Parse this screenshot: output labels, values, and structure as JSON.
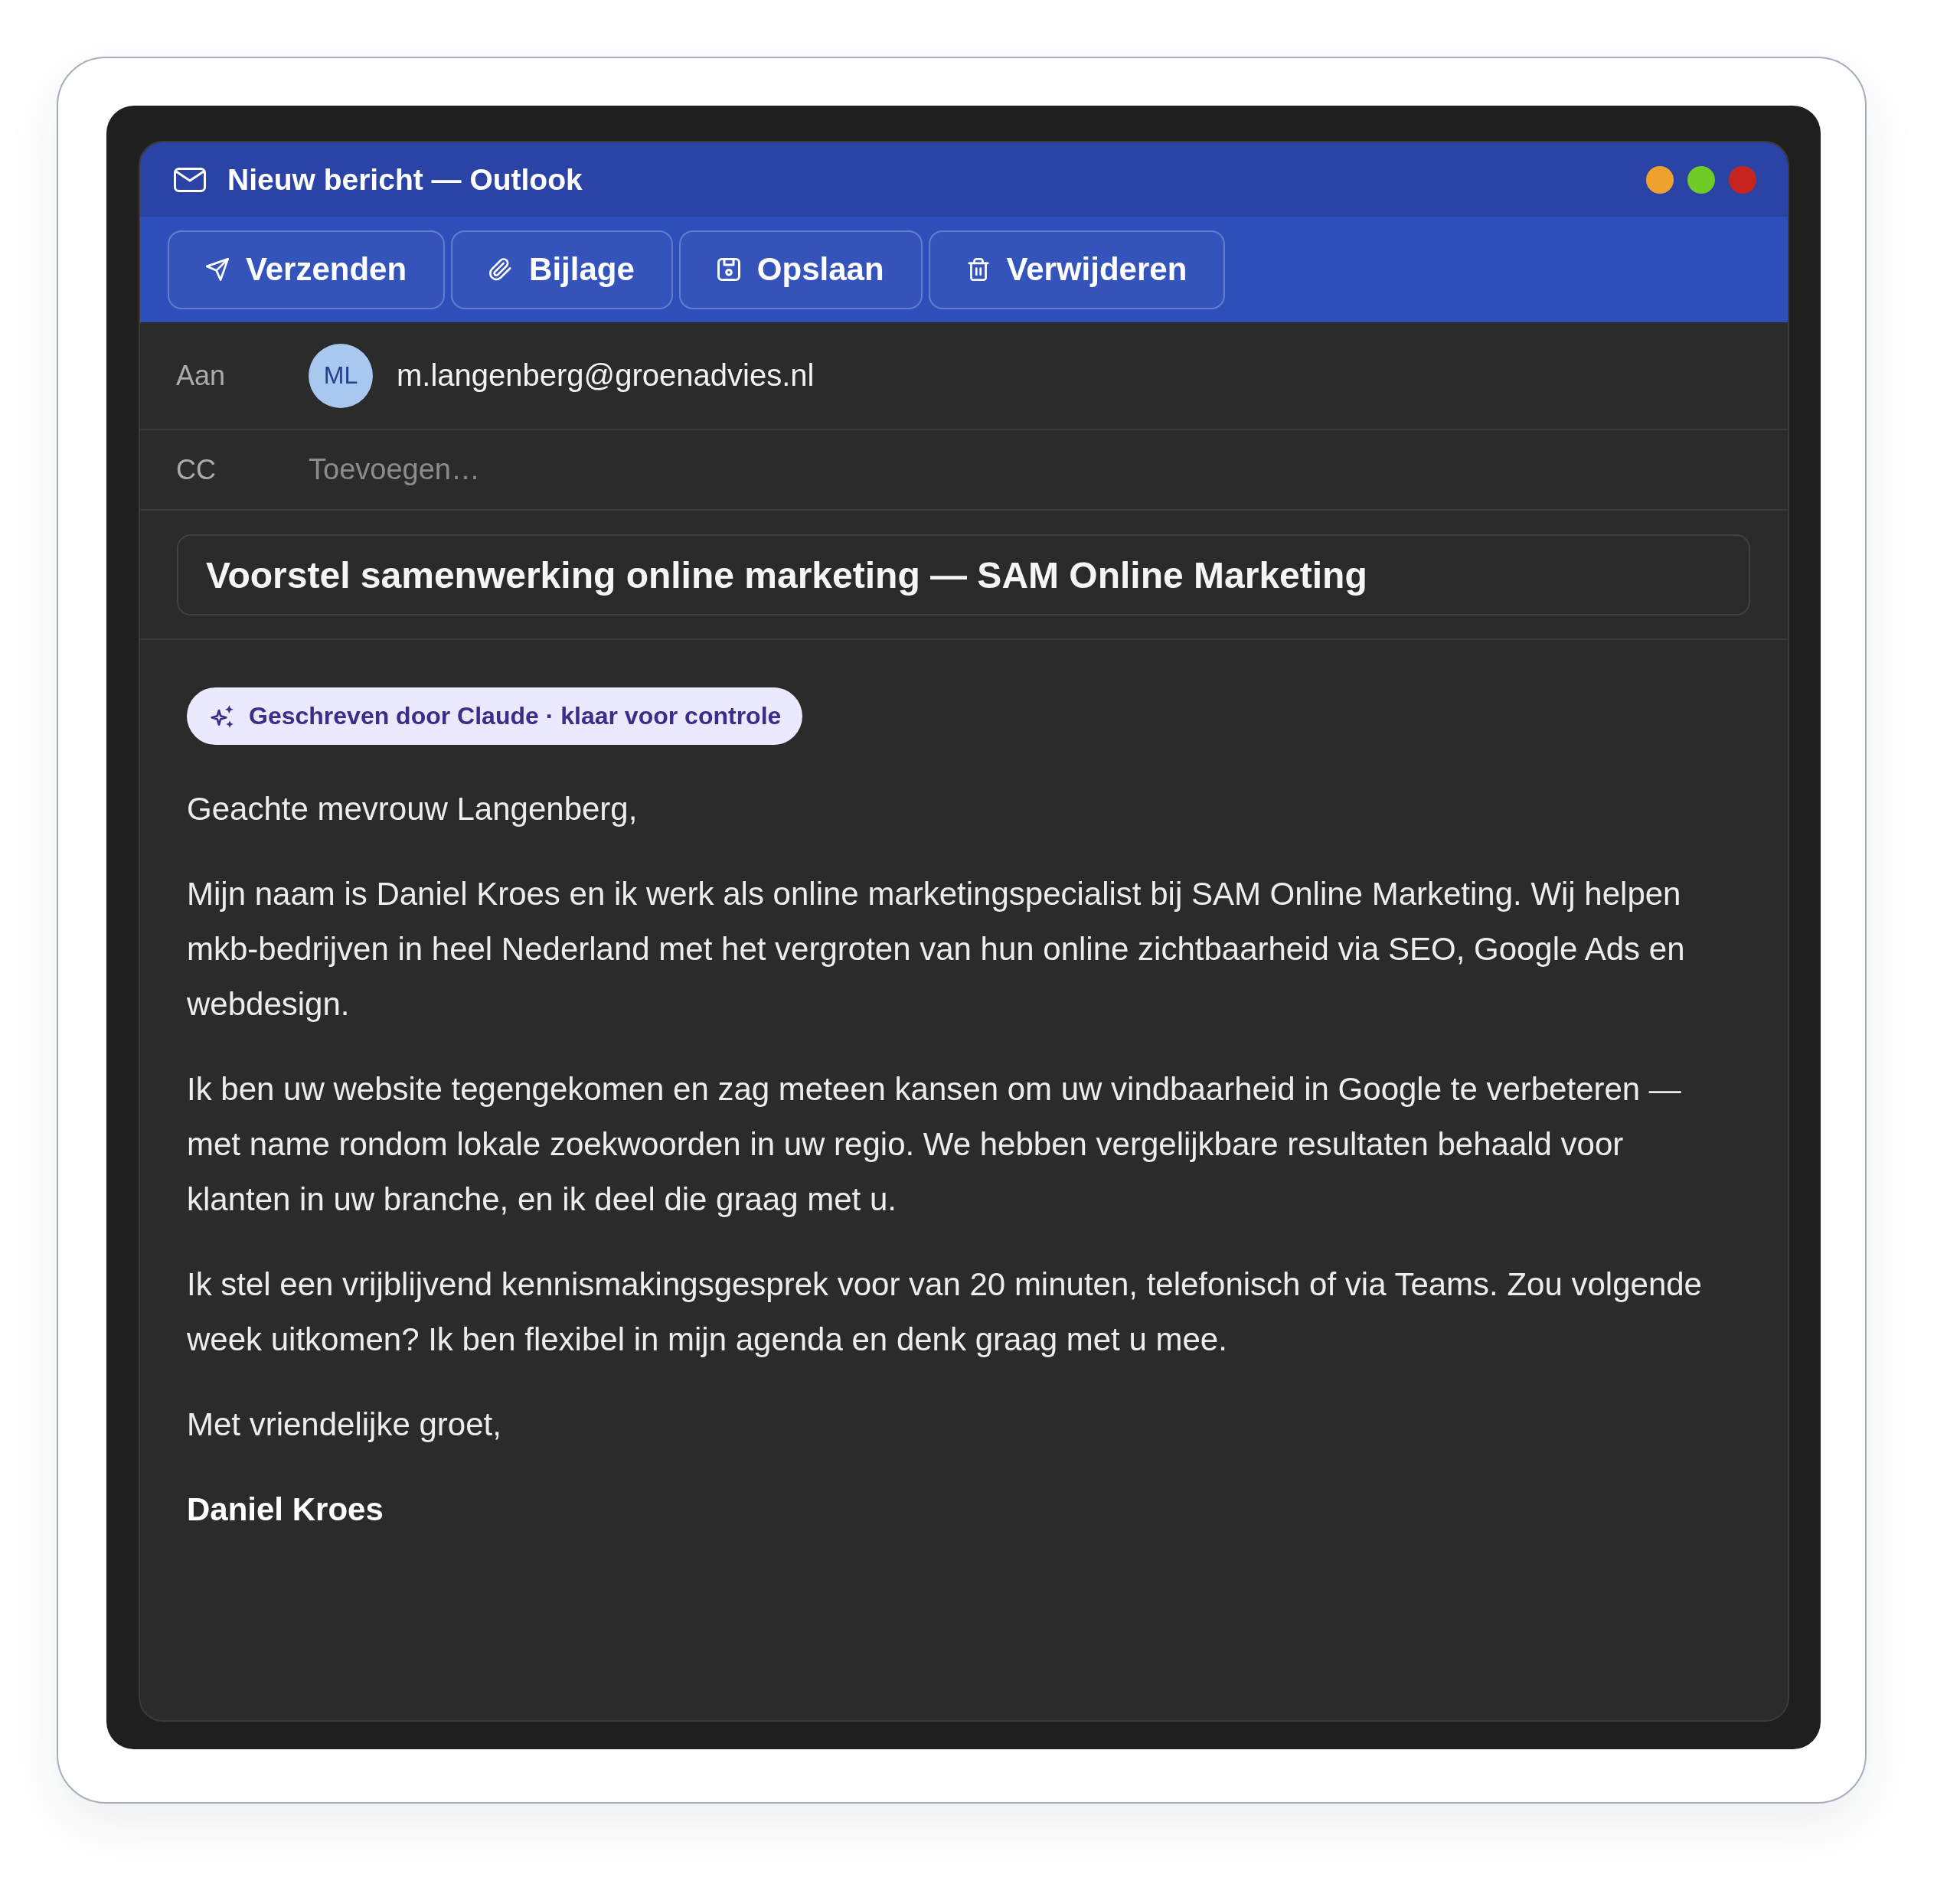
{
  "window": {
    "title": "Nieuw bericht — Outlook"
  },
  "toolbar": {
    "buttons": [
      {
        "kind": "send",
        "label": "Verzenden"
      },
      {
        "kind": "attach",
        "label": "Bijlage"
      },
      {
        "kind": "save",
        "label": "Opslaan"
      },
      {
        "kind": "delete",
        "label": "Verwijderen"
      }
    ]
  },
  "to": {
    "label": "Aan",
    "recipients": [
      {
        "initials": "ML",
        "address": "m.langenberg@groenadvies.nl"
      }
    ]
  },
  "cc": {
    "label": "CC",
    "placeholder": "Toevoegen…"
  },
  "subject": {
    "value": "Voorstel samenwerking online marketing — SAM Online Marketing"
  },
  "draft_badge": {
    "text": "Geschreven door Claude · klaar voor controle"
  },
  "body": {
    "paragraphs": [
      {
        "kind": "greeting",
        "text": "Geachte mevrouw Langenberg,"
      },
      {
        "kind": "paragraph",
        "text": "Mijn naam is Daniel Kroes en ik werk als online marketingspecialist bij SAM Online Marketing. Wij helpen mkb-bedrijven in heel Nederland met het vergroten van hun online zichtbaarheid via SEO, Google Ads en webdesign."
      },
      {
        "kind": "paragraph",
        "text": "Ik ben uw website tegengekomen en zag meteen kansen om uw vindbaarheid in Google te verbeteren — met name rondom lokale zoekwoorden in uw regio. We hebben vergelijkbare resultaten behaald voor klanten in uw branche, en ik deel die graag met u."
      },
      {
        "kind": "paragraph",
        "text": "Ik stel een vrijblijvend kennismakingsgesprek voor van 20 minuten, telefonisch of via Teams. Zou volgende week uitkomen? Ik ben flexibel in mijn agenda en denk graag met u mee."
      },
      {
        "kind": "closing",
        "text": "Met vriendelijke groet,"
      },
      {
        "kind": "signature",
        "text": "Daniel Kroes"
      }
    ]
  }
}
